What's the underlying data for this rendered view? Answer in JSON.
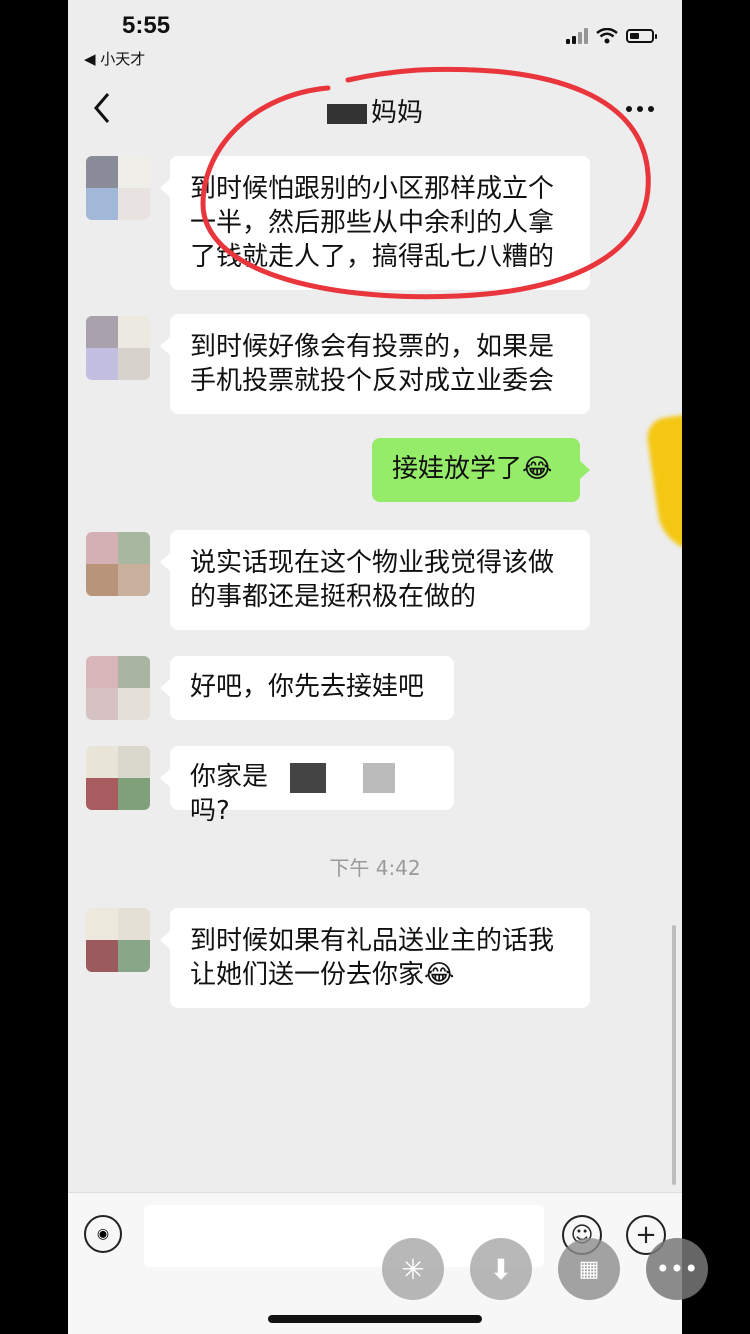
{
  "status_bar": {
    "time": "5:55",
    "back_app": "◀ 小天才"
  },
  "nav": {
    "title_suffix": "妈妈"
  },
  "messages": [
    {
      "text": "到时候怕跟别的小区那样成立个一半，然后那些从中余利的人拿了钱就走人了，搞得乱七八糟的"
    },
    {
      "text": "到时候好像会有投票的，如果是手机投票就投个反对成立业委会"
    },
    {
      "text": "接娃放学了",
      "emoji": "😂",
      "self": true
    },
    {
      "text": "说实话现在这个物业我觉得该做的事都还是挺积极在做的"
    },
    {
      "text": "好吧，你先去接娃吧"
    },
    {
      "prefix": "你家是",
      "suffix": "吗?"
    },
    {
      "text": "到时候如果有礼品送业主的话我让她们送一份去你家",
      "emoji": "😂"
    }
  ],
  "timestamp": "下午 4:42",
  "colors": {
    "self_bubble": "#95ec69",
    "background": "#ededed",
    "annotation_red": "#e8363c",
    "annotation_yellow": "#f5c400"
  },
  "icons": {
    "voice": "voice-icon",
    "emoji": "emoji-face-icon",
    "plus": "plus-icon"
  }
}
